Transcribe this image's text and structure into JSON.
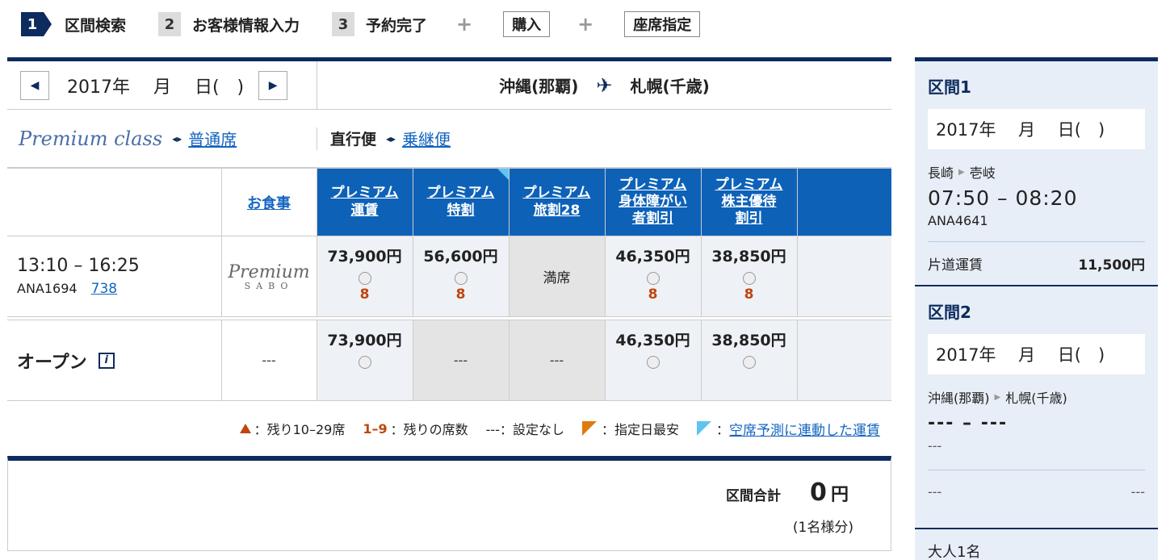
{
  "steps": [
    {
      "num": "1",
      "label": "区間検索",
      "active": true
    },
    {
      "num": "2",
      "label": "お客様情報入力"
    },
    {
      "num": "3",
      "label": "予約完了"
    }
  ],
  "options": {
    "plus": "+",
    "purchase": "購入",
    "seat": "座席指定"
  },
  "date_row": {
    "prev": "◀",
    "next": "▶",
    "date": "2017年　 月　 日(　)",
    "origin": "沖縄(那覇)",
    "destination": "札幌(千歳)",
    "plane_icon": "✈"
  },
  "class_row": {
    "premium": "Premium class",
    "swap": "◂▸",
    "regular": "普通席",
    "direct": "直行便",
    "connecting": "乗継便"
  },
  "table": {
    "meal_header": "お食事",
    "fare_headers": [
      "プレミアム運賃",
      "プレミアム特割",
      "プレミアム旅割28",
      "プレミアム身体障がい者割引",
      "プレミアム株主優待割引"
    ],
    "fare_headers_lines": [
      [
        "プレミアム",
        "運賃"
      ],
      [
        "プレミアム",
        "特割"
      ],
      [
        "プレミアム",
        "旅割28"
      ],
      [
        "プレミアム",
        "身体障がい",
        "者割引"
      ],
      [
        "プレミアム",
        "株主優待",
        "割引"
      ]
    ],
    "row1": {
      "time": "13:10 – 16:25",
      "flight": "ANA1694",
      "aircraft": "738",
      "meal_logo_top": "Premium",
      "meal_logo_bottom": "SABO",
      "fares": [
        {
          "price": "73,900円",
          "seats": "8"
        },
        {
          "price": "56,600円",
          "seats": "8"
        },
        {
          "status": "満席"
        },
        {
          "price": "46,350円",
          "seats": "8"
        },
        {
          "price": "38,850円",
          "seats": "8"
        }
      ]
    },
    "row2": {
      "label": "オープン",
      "info_icon": "i",
      "meal": "---",
      "fares": [
        {
          "price": "73,900円"
        },
        {
          "status": "---"
        },
        {
          "status": "---"
        },
        {
          "price": "46,350円"
        },
        {
          "price": "38,850円"
        }
      ]
    }
  },
  "legend": {
    "few": "：残り10–29席",
    "range": "1–9",
    "range_text": "：残りの席数",
    "none": "---：設定なし",
    "cheapest": "：指定日最安",
    "linked": "空席予測に連動した運賃"
  },
  "total": {
    "label": "区間合計",
    "amount": "0",
    "unit": "円",
    "note": "(1名様分)"
  },
  "sidebar": {
    "seg1": {
      "title": "区間1",
      "date": "2017年　 月　 日(　)",
      "from": "長崎",
      "to": "壱岐",
      "time": "07:50 – 08:20",
      "flight": "ANA4641",
      "fare_label": "片道運賃",
      "fare_amount": "11,500円"
    },
    "seg2": {
      "title": "区間2",
      "date": "2017年　 月　 日(　)",
      "from": "沖縄(那覇)",
      "to": "札幌(千歳)",
      "time": "--- – ---",
      "flight": "---",
      "fare_label": "---",
      "fare_amount": "---"
    },
    "passengers": "大人1名"
  },
  "colors": {
    "navy": "#0d2b5e",
    "fare_blue": "#0d62b8",
    "seat_orange": "#c0460c",
    "link": "#1565c0"
  }
}
